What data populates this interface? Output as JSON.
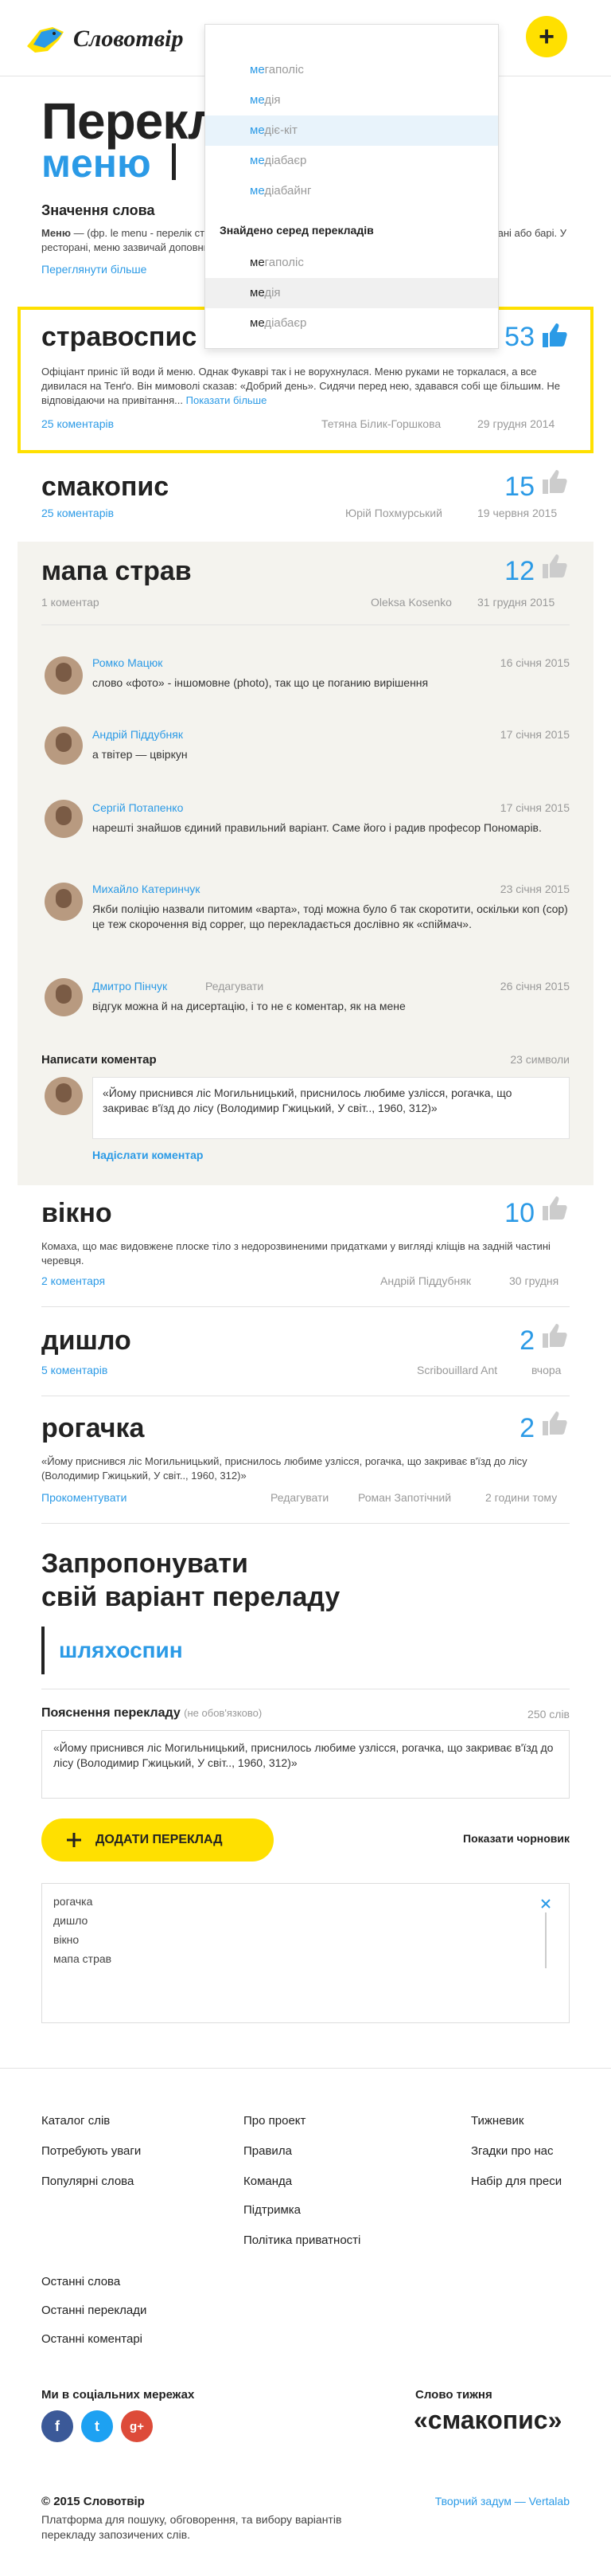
{
  "header": {
    "logo_text": "Словотвір",
    "search": {
      "value": "ме",
      "placeholder": ""
    },
    "add_button": "+"
  },
  "dropdown": {
    "suggestions": [
      {
        "prefix": "ме",
        "rest": "гаполіс"
      },
      {
        "prefix": "ме",
        "rest": "дія"
      },
      {
        "prefix": "ме",
        "rest": "діє-кіт"
      },
      {
        "prefix": "ме",
        "rest": "діабаєр"
      },
      {
        "prefix": "ме",
        "rest": "діабайнг"
      }
    ],
    "translations_heading": "Знайдено серед перекладів",
    "translations": [
      {
        "prefix": "ме",
        "rest": "гаполіс"
      },
      {
        "prefix": "ме",
        "rest": "дія"
      },
      {
        "prefix": "ме",
        "rest": "діабаєр"
      }
    ]
  },
  "hero": {
    "title": "Переклад",
    "word": "меню"
  },
  "meaning": {
    "heading": "Значення слова",
    "term": "Меню",
    "text": " — (фр. le menu - перелік страв) — перелік страв та напоїв, які можна замовити в ресторані або барі. У ресторані, меню зазвичай доповнюють, щоб дати уявлення про склад страв.",
    "more": "Переглянути більше"
  },
  "translations": [
    {
      "title": "стравоспис",
      "votes": "53",
      "excerpt": "Офіціант приніс їй води й меню. Однак Фукаврі так і не ворухнулася. Меню руками не торкалася, а все дивилася на Тенґо. Він мимоволі сказав: «Добрий день». Сидячи перед нею, здавався собі ще більшим. Не відповідаючи на привітання...",
      "show_more": "Показати більше",
      "comments": "25 коментарів",
      "author": "Тетяна Білик-Горшкова",
      "date": "29 грудня 2014"
    },
    {
      "title": "смакопис",
      "votes": "15",
      "comments": "25 коментарів",
      "author": "Юрій Похмурський",
      "date": "19 червня 2015"
    },
    {
      "title": "мапа страв",
      "votes": "12",
      "comments": "1 коментар",
      "author": "Oleksa Kosenko",
      "date": "31 грудня 2015"
    },
    {
      "title": "вікно",
      "votes": "10",
      "excerpt": "Комаха, що має видовжене плоске тіло з недорозвиненими придатками у вигляді кліщів на задній частині черевця.",
      "comments": "2 коментаря",
      "author": "Андрій Піддубняк",
      "date": "30 грудня"
    },
    {
      "title": "дишло",
      "votes": "2",
      "comments": "5 коментарів",
      "author": "Scribouillard Ant",
      "date": "вчора"
    },
    {
      "title": "рогачка",
      "votes": "2",
      "excerpt": "«Йому приснився ліс Могильницький, приснилось любиме узлісся, рогачка, що закриває в'їзд до лісу (Володимир Гжицький, У світ.., 1960, 312)»",
      "comments": "Прокоментувати",
      "edit": "Редагувати",
      "author": "Роман Запотічний",
      "date": "2 години тому"
    }
  ],
  "comments": [
    {
      "name": "Ромко Мацюк",
      "date": "16 січня 2015",
      "text": "слово «фото» - іншомовне (photo), так що це поганию вирішення"
    },
    {
      "name": "Андрій Піддубняк",
      "date": "17 січня 2015",
      "text": "а твітер — цвіркун"
    },
    {
      "name": "Сергій Потапенко",
      "date": "17 січня 2015",
      "text": "нарешті знайшов єдиний правильний варіант. Саме його і радив професор Пономарів."
    },
    {
      "name": "Михайло Катеринчук",
      "date": "23 січня 2015",
      "text": "Якби поліцію назвали питомим «варта», тоді можна було б так скоротити, оскільки коп (cop) це теж скорочення від copper, що перекладається дослівно як «спіймач»."
    },
    {
      "name": "Дмитро Пінчук",
      "edit": "Редагувати",
      "date": "26 січня 2015",
      "text": "відгук можна й на дисертацію, і то не є коментар, як на мене"
    }
  ],
  "write_comment": {
    "heading": "Написати коментар",
    "counter": "23 символи",
    "value": "«Йому приснився ліс Могильницький, приснилось любиме узлісся, рогачка, що закриває в'їзд до лісу (Володимир Гжицький, У світ.., 1960, 312)»",
    "submit": "Надіслати коментар"
  },
  "propose": {
    "heading_line1": "Запропонувати",
    "heading_line2": "свій варіант переладу",
    "input_value": "шляхоспин",
    "expl_label": "Пояснення перекладу",
    "expl_optional": "(не обов'язково)",
    "expl_counter": "250 слів",
    "expl_value": "«Йому приснився ліс Могильницький, приснилось любиме узлісся, рогачка, що закриває в'їзд до лісу (Володимир Гжицький, У світ.., 1960, 312)»",
    "add_button": "ДОДАТИ ПЕРЕКЛАД",
    "show_draft": "Показати чорновик",
    "draft_items": [
      "рогачка",
      "дишло",
      "вікно",
      "мапа страв"
    ]
  },
  "footer": {
    "col1": [
      "Каталог слів",
      "Потребують уваги",
      "Популярні слова",
      "Останні слова",
      "Останні переклади",
      "Останні коментарі"
    ],
    "col2": [
      "Про проект",
      "Правила",
      "Команда",
      "Підтримка",
      "Політика приватності"
    ],
    "col3": [
      "Тижневик",
      "Згадки про нас",
      "Набір для преси"
    ],
    "social_heading": "Ми в соціальних мережах",
    "social": [
      "f",
      "t",
      "g+"
    ],
    "word_week_label": "Слово тижня",
    "word_week": "«смакопис»",
    "copyright": "© 2015 Словотвір",
    "tagline": "Платформа для пошуку, обговорення, та вибору варіантів перекладу запозичених слів.",
    "credit": "Творчий задум — Vertalab"
  },
  "colors": {
    "accent": "#2b9ae6",
    "highlight": "#ffe000",
    "comment_bg": "#f4f3ee"
  }
}
